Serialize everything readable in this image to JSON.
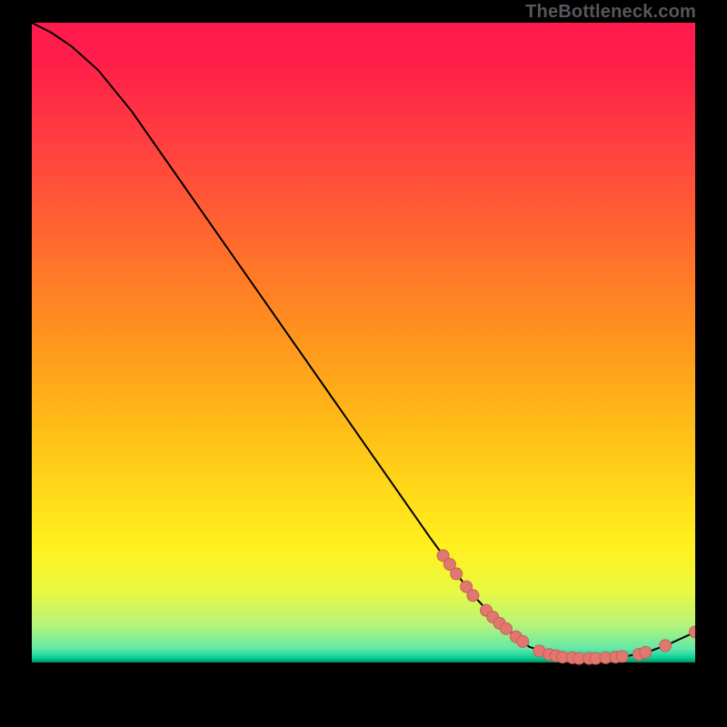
{
  "watermark": "TheBottleneck.com",
  "colors": {
    "curve": "#000000",
    "marker_fill": "#e07870",
    "marker_stroke": "#cc5e56"
  },
  "chart_data": {
    "type": "line",
    "title": "",
    "xlabel": "",
    "ylabel": "",
    "xlim": [
      0,
      100
    ],
    "ylim": [
      0,
      100
    ],
    "grid": false,
    "series": [
      {
        "name": "curve",
        "x": [
          0,
          3,
          6,
          10,
          15,
          20,
          25,
          30,
          35,
          40,
          45,
          50,
          55,
          60,
          63,
          66,
          70,
          75,
          80,
          83,
          85,
          88,
          90,
          93,
          96,
          100
        ],
        "y": [
          100,
          98.5,
          96.5,
          93,
          87,
          80,
          73,
          66,
          59,
          52,
          45,
          38,
          31,
          24,
          20,
          16,
          11.8,
          7.8,
          6.3,
          6.1,
          6.1,
          6.2,
          6.5,
          7.1,
          8.2,
          10
        ]
      }
    ],
    "markers": [
      {
        "x": 62.0,
        "y": 21.3
      },
      {
        "x": 63.0,
        "y": 20.0
      },
      {
        "x": 64.0,
        "y": 18.6
      },
      {
        "x": 65.5,
        "y": 16.7
      },
      {
        "x": 66.5,
        "y": 15.4
      },
      {
        "x": 68.5,
        "y": 13.2
      },
      {
        "x": 69.5,
        "y": 12.2
      },
      {
        "x": 70.5,
        "y": 11.3
      },
      {
        "x": 71.5,
        "y": 10.5
      },
      {
        "x": 73.0,
        "y": 9.3
      },
      {
        "x": 74.0,
        "y": 8.6
      },
      {
        "x": 76.5,
        "y": 7.2
      },
      {
        "x": 78.0,
        "y": 6.7
      },
      {
        "x": 79.0,
        "y": 6.5
      },
      {
        "x": 80.0,
        "y": 6.3
      },
      {
        "x": 81.5,
        "y": 6.2
      },
      {
        "x": 82.5,
        "y": 6.1
      },
      {
        "x": 84.0,
        "y": 6.1
      },
      {
        "x": 85.0,
        "y": 6.1
      },
      {
        "x": 86.5,
        "y": 6.2
      },
      {
        "x": 88.0,
        "y": 6.3
      },
      {
        "x": 89.0,
        "y": 6.4
      },
      {
        "x": 91.5,
        "y": 6.7
      },
      {
        "x": 92.5,
        "y": 7.0
      },
      {
        "x": 95.5,
        "y": 8.0
      },
      {
        "x": 100.0,
        "y": 10.0
      }
    ]
  }
}
